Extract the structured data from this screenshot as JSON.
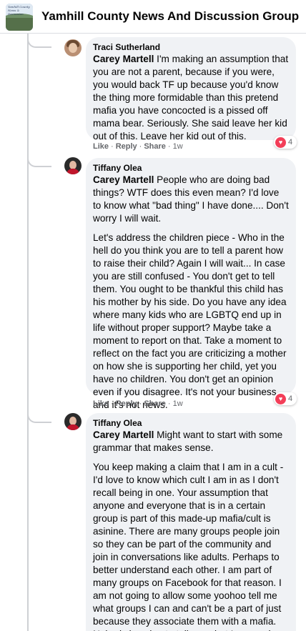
{
  "header": {
    "group_name": "Yamhill County News And Discussion Group",
    "thumb_text": "Yamhill County News & Discussion"
  },
  "comments": [
    {
      "author": "Traci Sutherland",
      "mention": "Carey Martell",
      "paragraphs": [
        "I'm making an assumption that you are not a parent, because if you were, you would back TF up because you'd know the thing more formidable than this pretend mafia you have concocted is a pissed off mama bear. Seriously. She said leave her kid out of this. Leave her kid out of this."
      ],
      "actions": {
        "like": "Like",
        "reply": "Reply",
        "share": "Share",
        "time": "1w"
      },
      "reaction": {
        "icon": "heart-icon",
        "count": "4"
      }
    },
    {
      "author": "Tiffany Olea",
      "mention": "Carey Martell",
      "paragraphs": [
        "People who are doing bad things? WTF does this even mean? I'd love to know what \"bad thing\" I have done.... Don't worry I will wait.",
        "Let's address the children piece - Who in the hell do you think you are to tell a parent how to raise their child? Again I will wait... In case you are still confused - You don't get to tell them. You ought to be thankful this child has his mother by his side. Do you have any idea where many kids who are LGBTQ end up in life without proper support? Maybe take a moment to report on that. Take a moment to reflect on the fact you are criticizing a mother on how she is supporting her child, yet you have no children. You don't get an opinion even if you disagree. It's not your business and it's not news."
      ],
      "actions": {
        "like": "Like",
        "reply": "Reply",
        "share": "Share",
        "time": "1w"
      },
      "reaction": {
        "icon": "heart-icon",
        "count": "4"
      }
    },
    {
      "author": "Tiffany Olea",
      "mention": "Carey Martell",
      "paragraphs": [
        "Might want to start with some grammar that makes sense.",
        "You keep making a claim that I am in a cult - I'd love to know which cult I am in as I don't recall being in one. Your assumption that anyone and everyone that is in a certain group is part of this made-up mafia/cult is asinine. There are many groups people join so they can be part of the community and join in conversations like adults. Perhaps to better understand each other. I am part of many groups on Facebook for that reason. I am not going to allow some yoohoo tell me what groups I can and can't be a part of just because they associate them with a mafia. Nobody is going to tell me what I can and can't believe in or support and if that makes"
      ]
    }
  ],
  "colors": {
    "bubble": "#f0f2f5",
    "heart": "#f33e58",
    "meta_text": "#65676b"
  }
}
